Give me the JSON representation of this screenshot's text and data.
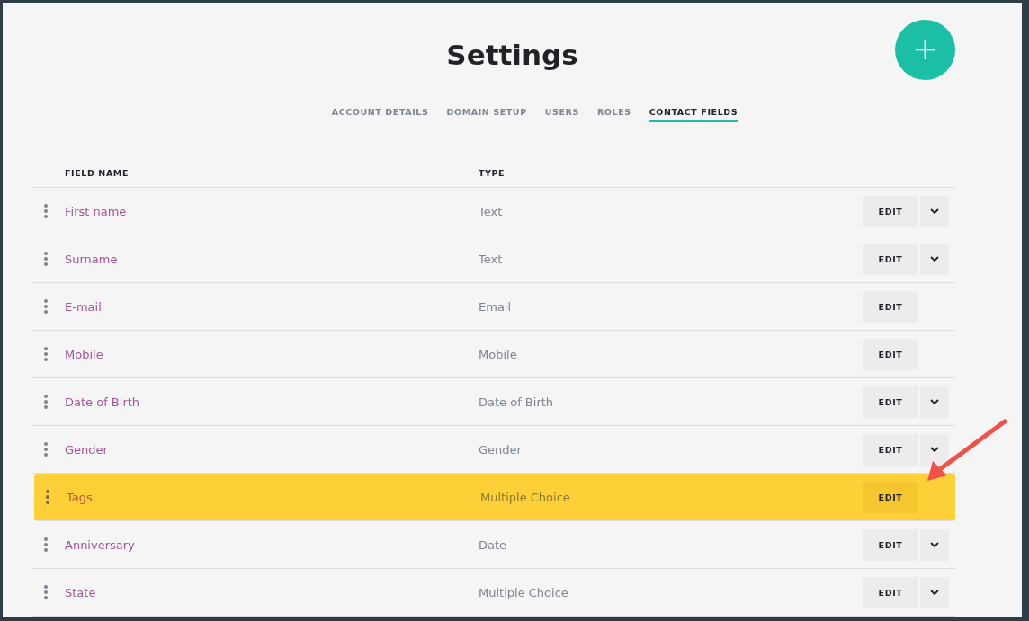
{
  "title": "Settings",
  "add_button": {
    "label": "+"
  },
  "tabs": [
    {
      "label": "ACCOUNT DETAILS",
      "selected": false
    },
    {
      "label": "DOMAIN SETUP",
      "selected": false
    },
    {
      "label": "USERS",
      "selected": false
    },
    {
      "label": "ROLES",
      "selected": false
    },
    {
      "label": "CONTACT FIELDS",
      "selected": true
    }
  ],
  "table": {
    "columns": [
      "FIELD NAME",
      "TYPE"
    ],
    "rows": [
      {
        "name": "First name",
        "type": "Text",
        "action": "EDIT",
        "has_menu": true,
        "highlighted": false
      },
      {
        "name": "Surname",
        "type": "Text",
        "action": "EDIT",
        "has_menu": true,
        "highlighted": false
      },
      {
        "name": "E-mail",
        "type": "Email",
        "action": "EDIT",
        "has_menu": false,
        "highlighted": false
      },
      {
        "name": "Mobile",
        "type": "Mobile",
        "action": "EDIT",
        "has_menu": false,
        "highlighted": false
      },
      {
        "name": "Date of Birth",
        "type": "Date of Birth",
        "action": "EDIT",
        "has_menu": true,
        "highlighted": false
      },
      {
        "name": "Gender",
        "type": "Gender",
        "action": "EDIT",
        "has_menu": true,
        "highlighted": false
      },
      {
        "name": "Tags",
        "type": "Multiple Choice",
        "action": "EDIT",
        "has_menu": false,
        "highlighted": true
      },
      {
        "name": "Anniversary",
        "type": "Date",
        "action": "EDIT",
        "has_menu": true,
        "highlighted": false
      },
      {
        "name": "State",
        "type": "Multiple Choice",
        "action": "EDIT",
        "has_menu": true,
        "highlighted": false
      }
    ]
  }
}
